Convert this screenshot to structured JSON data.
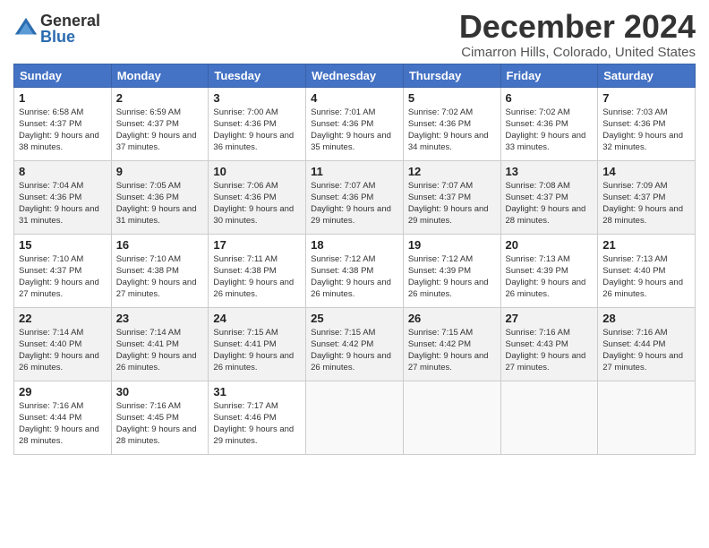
{
  "logo": {
    "general": "General",
    "blue": "Blue",
    "arrow_color": "#2b6cb0"
  },
  "title": "December 2024",
  "location": "Cimarron Hills, Colorado, United States",
  "days_of_week": [
    "Sunday",
    "Monday",
    "Tuesday",
    "Wednesday",
    "Thursday",
    "Friday",
    "Saturday"
  ],
  "weeks": [
    [
      {
        "day": "1",
        "sunrise": "6:58 AM",
        "sunset": "4:37 PM",
        "daylight": "9 hours and 38 minutes."
      },
      {
        "day": "2",
        "sunrise": "6:59 AM",
        "sunset": "4:37 PM",
        "daylight": "9 hours and 37 minutes."
      },
      {
        "day": "3",
        "sunrise": "7:00 AM",
        "sunset": "4:36 PM",
        "daylight": "9 hours and 36 minutes."
      },
      {
        "day": "4",
        "sunrise": "7:01 AM",
        "sunset": "4:36 PM",
        "daylight": "9 hours and 35 minutes."
      },
      {
        "day": "5",
        "sunrise": "7:02 AM",
        "sunset": "4:36 PM",
        "daylight": "9 hours and 34 minutes."
      },
      {
        "day": "6",
        "sunrise": "7:02 AM",
        "sunset": "4:36 PM",
        "daylight": "9 hours and 33 minutes."
      },
      {
        "day": "7",
        "sunrise": "7:03 AM",
        "sunset": "4:36 PM",
        "daylight": "9 hours and 32 minutes."
      }
    ],
    [
      {
        "day": "8",
        "sunrise": "7:04 AM",
        "sunset": "4:36 PM",
        "daylight": "9 hours and 31 minutes."
      },
      {
        "day": "9",
        "sunrise": "7:05 AM",
        "sunset": "4:36 PM",
        "daylight": "9 hours and 31 minutes."
      },
      {
        "day": "10",
        "sunrise": "7:06 AM",
        "sunset": "4:36 PM",
        "daylight": "9 hours and 30 minutes."
      },
      {
        "day": "11",
        "sunrise": "7:07 AM",
        "sunset": "4:36 PM",
        "daylight": "9 hours and 29 minutes."
      },
      {
        "day": "12",
        "sunrise": "7:07 AM",
        "sunset": "4:37 PM",
        "daylight": "9 hours and 29 minutes."
      },
      {
        "day": "13",
        "sunrise": "7:08 AM",
        "sunset": "4:37 PM",
        "daylight": "9 hours and 28 minutes."
      },
      {
        "day": "14",
        "sunrise": "7:09 AM",
        "sunset": "4:37 PM",
        "daylight": "9 hours and 28 minutes."
      }
    ],
    [
      {
        "day": "15",
        "sunrise": "7:10 AM",
        "sunset": "4:37 PM",
        "daylight": "9 hours and 27 minutes."
      },
      {
        "day": "16",
        "sunrise": "7:10 AM",
        "sunset": "4:38 PM",
        "daylight": "9 hours and 27 minutes."
      },
      {
        "day": "17",
        "sunrise": "7:11 AM",
        "sunset": "4:38 PM",
        "daylight": "9 hours and 26 minutes."
      },
      {
        "day": "18",
        "sunrise": "7:12 AM",
        "sunset": "4:38 PM",
        "daylight": "9 hours and 26 minutes."
      },
      {
        "day": "19",
        "sunrise": "7:12 AM",
        "sunset": "4:39 PM",
        "daylight": "9 hours and 26 minutes."
      },
      {
        "day": "20",
        "sunrise": "7:13 AM",
        "sunset": "4:39 PM",
        "daylight": "9 hours and 26 minutes."
      },
      {
        "day": "21",
        "sunrise": "7:13 AM",
        "sunset": "4:40 PM",
        "daylight": "9 hours and 26 minutes."
      }
    ],
    [
      {
        "day": "22",
        "sunrise": "7:14 AM",
        "sunset": "4:40 PM",
        "daylight": "9 hours and 26 minutes."
      },
      {
        "day": "23",
        "sunrise": "7:14 AM",
        "sunset": "4:41 PM",
        "daylight": "9 hours and 26 minutes."
      },
      {
        "day": "24",
        "sunrise": "7:15 AM",
        "sunset": "4:41 PM",
        "daylight": "9 hours and 26 minutes."
      },
      {
        "day": "25",
        "sunrise": "7:15 AM",
        "sunset": "4:42 PM",
        "daylight": "9 hours and 26 minutes."
      },
      {
        "day": "26",
        "sunrise": "7:15 AM",
        "sunset": "4:42 PM",
        "daylight": "9 hours and 27 minutes."
      },
      {
        "day": "27",
        "sunrise": "7:16 AM",
        "sunset": "4:43 PM",
        "daylight": "9 hours and 27 minutes."
      },
      {
        "day": "28",
        "sunrise": "7:16 AM",
        "sunset": "4:44 PM",
        "daylight": "9 hours and 27 minutes."
      }
    ],
    [
      {
        "day": "29",
        "sunrise": "7:16 AM",
        "sunset": "4:44 PM",
        "daylight": "9 hours and 28 minutes."
      },
      {
        "day": "30",
        "sunrise": "7:16 AM",
        "sunset": "4:45 PM",
        "daylight": "9 hours and 28 minutes."
      },
      {
        "day": "31",
        "sunrise": "7:17 AM",
        "sunset": "4:46 PM",
        "daylight": "9 hours and 29 minutes."
      },
      null,
      null,
      null,
      null
    ]
  ]
}
